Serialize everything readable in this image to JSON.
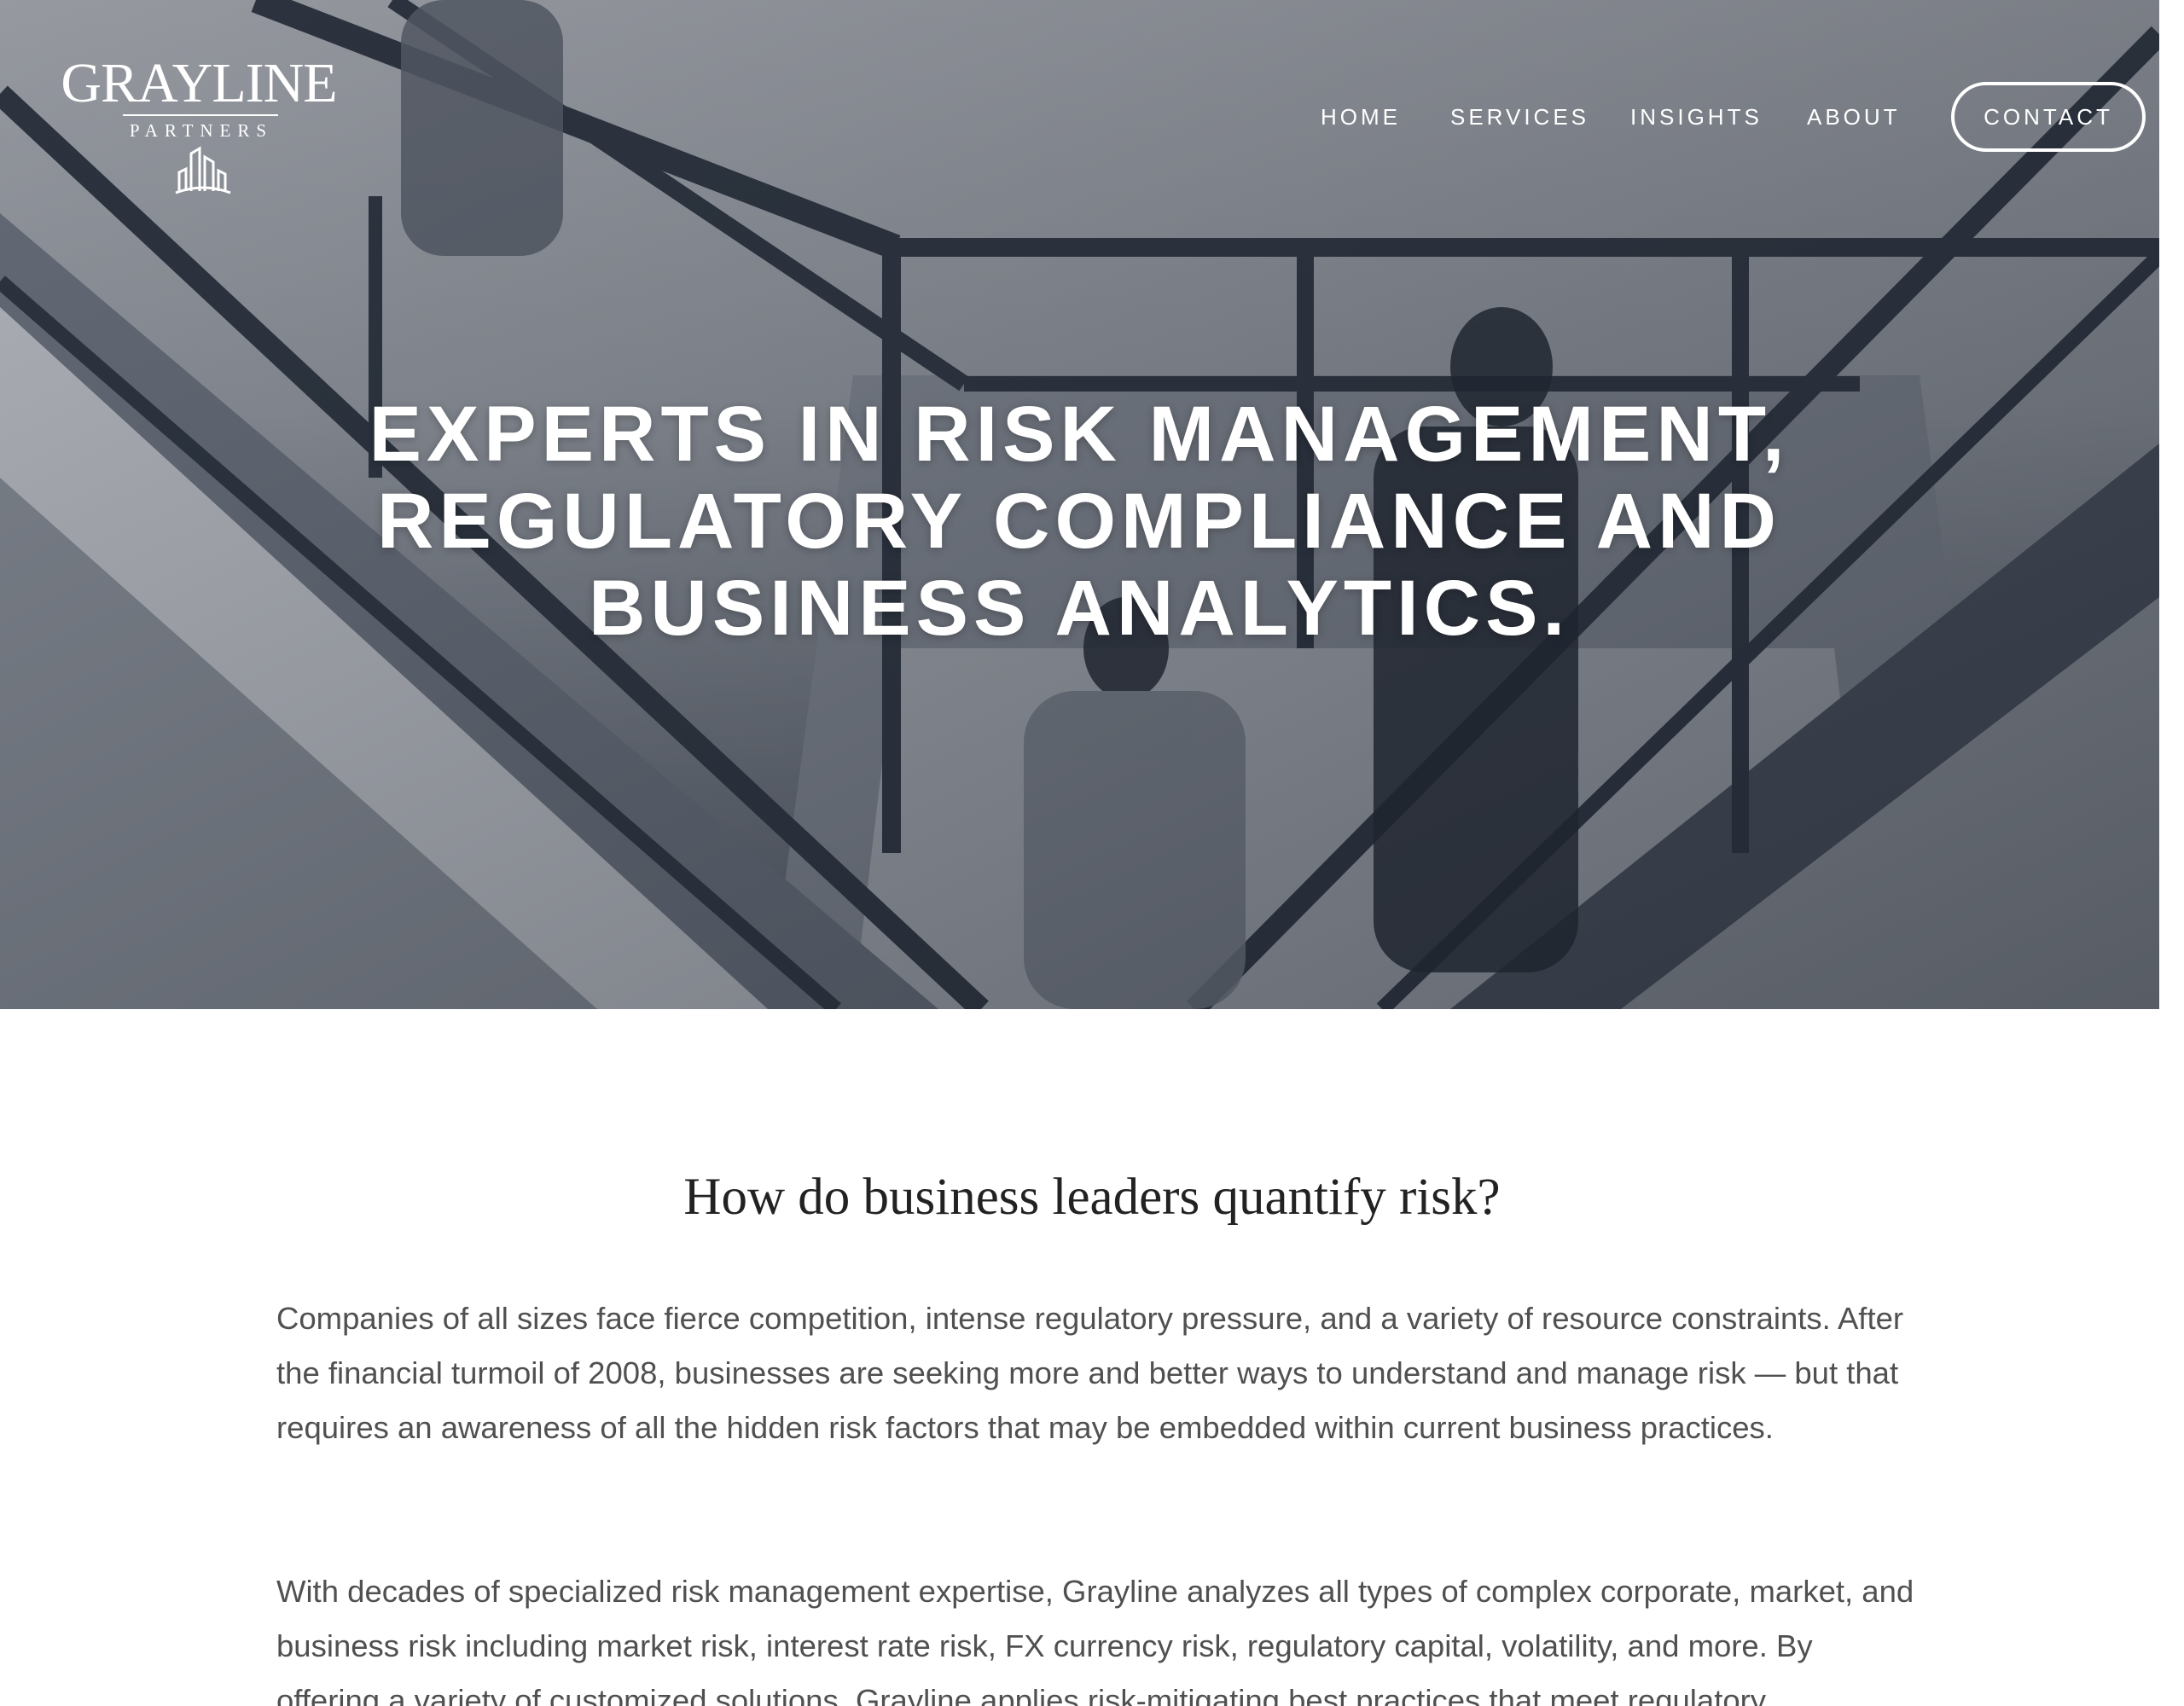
{
  "brand": {
    "name": "GRAYLINE",
    "tagline": "PARTNERS",
    "text_color": "#ffffff"
  },
  "nav": {
    "items": [
      {
        "label": "HOME"
      },
      {
        "label": "SERVICES"
      },
      {
        "label": "INSIGHTS"
      },
      {
        "label": "ABOUT"
      }
    ],
    "contact_label": "CONTACT"
  },
  "hero": {
    "headline": "EXPERTS IN RISK MANAGEMENT, REGULATORY COMPLIANCE AND BUSINESS ANALYTICS.",
    "overlay_color": "#3c4452"
  },
  "intro": {
    "heading": "How do business leaders quantify risk?",
    "paragraphs": [
      "Companies of all sizes face fierce competition, intense regulatory pressure, and a variety of resource constraints. After the financial turmoil of 2008, businesses are seeking more and better ways to understand and manage risk — but that requires an awareness of all the hidden risk factors that may be embedded within current business practices.",
      "With decades of specialized risk management expertise, Grayline analyzes all types of complex corporate, market, and business risk including market risk, interest rate risk, FX currency risk, regulatory capital, volatility, and more. By offering a variety of customized solutions, Grayline applies risk-mitigating best practices that meet regulatory"
    ]
  },
  "colors": {
    "heading": "#222222",
    "body_text": "#505050",
    "background": "#ffffff"
  }
}
